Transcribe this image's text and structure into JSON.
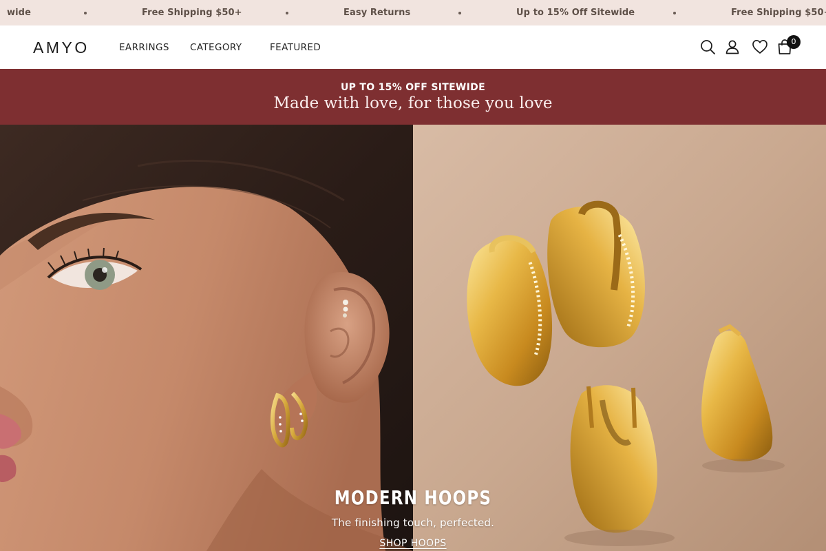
{
  "announcement_bar": {
    "items": [
      "wide",
      "Free Shipping $50+",
      "Easy Returns",
      "Up to 15% Off Sitewide",
      "Free Shipping $50+"
    ],
    "separator": "•"
  },
  "header": {
    "logo": "AMYO",
    "nav": [
      {
        "label": "EARRINGS"
      },
      {
        "label": "CATEGORY"
      },
      {
        "label": "FEATURED"
      }
    ],
    "icons": [
      "search-icon",
      "account-icon",
      "wishlist-icon",
      "cart-icon"
    ],
    "cart_count": "0"
  },
  "promo": {
    "kicker": "UP TO 15% OFF SITEWIDE",
    "headline": "Made with love, for those you love",
    "background": "#7e2f31"
  },
  "hero": {
    "title": "MODERN HOOPS",
    "subtitle": "The finishing touch, perfected.",
    "cta": "SHOP HOOPS"
  },
  "colors": {
    "announcement_bg": "#f1e4df",
    "promo_bg": "#7e2f31",
    "gold": "#d9a53a"
  }
}
